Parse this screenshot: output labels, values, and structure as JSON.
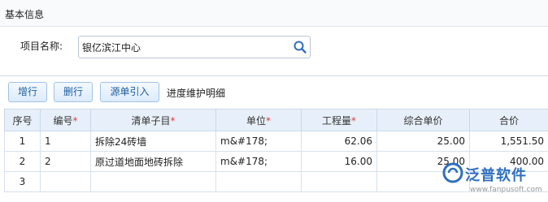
{
  "section": {
    "title": "基本信息"
  },
  "project": {
    "label": "项目名称:",
    "value": "银亿滨江中心"
  },
  "toolbar": {
    "buttons": [
      "增行",
      "删行",
      "源单引入"
    ],
    "title": "进度维护明细"
  },
  "table": {
    "columns": [
      {
        "label": "序号",
        "required": ""
      },
      {
        "label": "编号",
        "required": "*"
      },
      {
        "label": "清单子目",
        "required": "*"
      },
      {
        "label": "单位",
        "required": "*"
      },
      {
        "label": "工程量",
        "required": "*"
      },
      {
        "label": "综合单价",
        "required": ""
      },
      {
        "label": "合价",
        "required": ""
      }
    ],
    "rows": [
      [
        "1",
        "1",
        "拆除24砖墙",
        "m&#178;",
        "62.06",
        "25.00",
        "1,551.50"
      ],
      [
        "2",
        "2",
        "原过道地面地砖拆除",
        "m&#178;",
        "16.00",
        "25.00",
        "400.00"
      ],
      [
        "3",
        "",
        "",
        "",
        "",
        "",
        ""
      ]
    ]
  },
  "watermark": {
    "brand": "泛普软件",
    "url": "www.fanpusoft.com"
  },
  "colors": {
    "accent": "#2f6fbf",
    "button_text": "#1f5f9f",
    "header_bg": "#e7f0fa",
    "required": "#e23b3b"
  }
}
